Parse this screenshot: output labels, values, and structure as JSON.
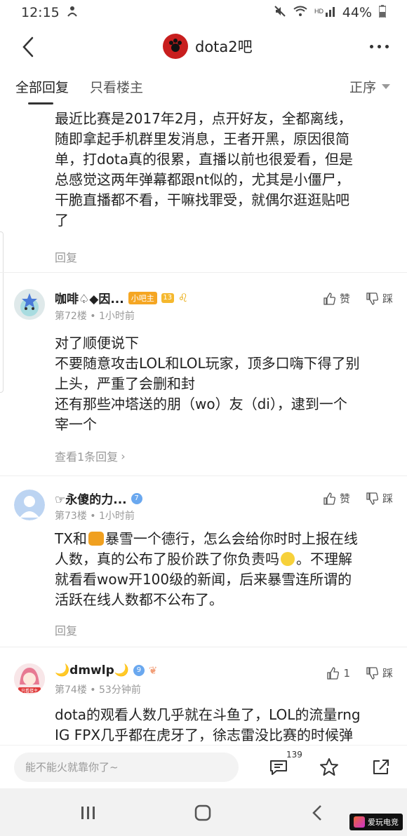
{
  "status": {
    "time": "12:15",
    "battery": "44%"
  },
  "header": {
    "forum_name": "dota2吧"
  },
  "tabs": {
    "all": "全部回复",
    "owner_only": "只看楼主",
    "sort": "正序"
  },
  "post0": {
    "text": "最近比赛是2017年2月，点开好友，全都离线，\n随即拿起手机群里发消息，王者开黑，原因很简\n单，打dota真的很累，直播以前也很爱看，但是\n总感觉这两年弹幕都跟nt似的，尤其是小僵尸，\n干脆直播都不看，干嘛找罪受，就偶尔逛逛贴吧\n了",
    "reply_label": "回复"
  },
  "post1": {
    "username": "咖啡♤◆因...",
    "owner_badge": "小吧主",
    "level": "13",
    "floor": "第72楼",
    "dot": "•",
    "time": "1小时前",
    "like": "赞",
    "dislike": "踩",
    "text": "对了顺便说下\n不要随意攻击LOL和LOL玩家，顶多口嗨下得了别\n上头，严重了会删和封\n还有那些冲塔送的朋（wo）友（di），逮到一个\n宰一个",
    "view_replies": "查看1条回复"
  },
  "post2": {
    "username": "☞永傻的力...",
    "level": "7",
    "floor": "第73楼",
    "dot": "•",
    "time": "1小时前",
    "like": "赞",
    "dislike": "踩",
    "text_a": "TX和",
    "text_b": "暴雪一个德行，怎么会给你时时上报在线\n人数，真的公布了股价跌了你负责吗",
    "text_c": "。不理解\n就看看wow开100级的新闻，后来暴雪连所谓的\n活跃在线人数都不公布了。",
    "reply_label": "回复"
  },
  "post3": {
    "username": "🌙dmwlp🌙",
    "level": "9",
    "floor": "第74楼",
    "dot": "•",
    "time": "53分钟前",
    "like_count": "1",
    "dislike": "踩",
    "avatar_tag": "只看楼主",
    "text": "dota的观看人数几乎就在斗鱼了，LOL的流量rng\nIG FPX几乎都在虎牙了，徐志雷没比赛的时候弹"
  },
  "bottom": {
    "placeholder": "能不能火就靠你了~",
    "comment_count": "139"
  },
  "watermark": "爱玩电竞",
  "colors": {
    "accent": "#3a7bd5",
    "owner_badge": "#f5a623",
    "forum_logo": "#c81e1e"
  }
}
